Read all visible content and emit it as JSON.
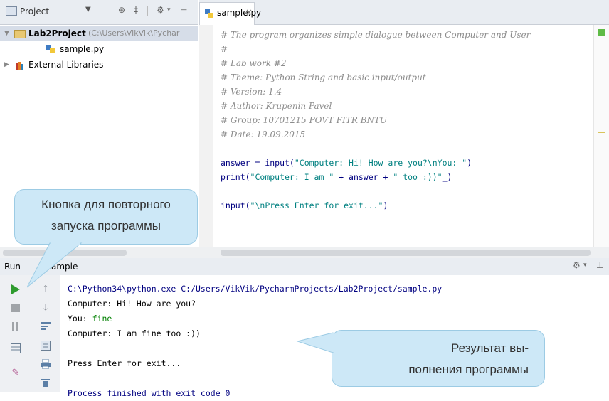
{
  "project_panel": {
    "title": "Project",
    "root_label": "Lab2Project",
    "root_path": "(C:\\Users\\VikVik\\Pychar",
    "file_label": "sample.py",
    "ext_libs_label": "External Libraries"
  },
  "editor": {
    "tab_label": "sample.py",
    "tab_close": "×",
    "lines": [
      {
        "type": "comment",
        "text": "# The program organizes simple dialogue between Computer and User"
      },
      {
        "type": "comment",
        "text": "#"
      },
      {
        "type": "comment",
        "text": "# Lab work #2"
      },
      {
        "type": "comment",
        "text": "# Theme: Python String and basic input/output"
      },
      {
        "type": "comment",
        "text": "# Version: 1.4"
      },
      {
        "type": "comment",
        "text": "# Author: Krupenin Pavel"
      },
      {
        "type": "comment",
        "text": "# Group: 10701215 POVT FITR BNTU"
      },
      {
        "type": "comment",
        "text": "# Date: 19.09.2015"
      },
      {
        "type": "blank",
        "text": ""
      },
      {
        "type": "code1",
        "a": "answer = input(",
        "s": "\"Computer: Hi! How are you?\\nYou: \"",
        "b": ")"
      },
      {
        "type": "code2",
        "a": "print(",
        "s1": "\"Computer: I am \"",
        "m": " + answer + ",
        "s2": "\" too :))\"",
        "b": "_)"
      },
      {
        "type": "blank",
        "text": ""
      },
      {
        "type": "code3",
        "a": "input(",
        "s": "\"\\nPress Enter for exit...\"",
        "b": ")"
      }
    ]
  },
  "run_panel": {
    "title_prefix": "Run",
    "title_suffix": "ample",
    "console_lines": [
      {
        "text": "C:\\Python34\\python.exe C:/Users/VikVik/PycharmProjects/Lab2Project/sample.py",
        "color": "#000080"
      },
      {
        "text": "Computer: Hi! How are you?",
        "color": "#000000"
      },
      {
        "prefix": "You: ",
        "input": "fine",
        "color": "#000000",
        "input_color": "#008000"
      },
      {
        "text": "Computer: I am fine too :))",
        "color": "#000000"
      },
      {
        "text": "",
        "color": "#000000"
      },
      {
        "text": "Press Enter for exit...",
        "color": "#000000"
      },
      {
        "text": "",
        "color": "#000000"
      },
      {
        "text": "Process finished with exit code 0",
        "color": "#000080"
      }
    ]
  },
  "callouts": {
    "rerun": {
      "line1": "Кнопка для повторного",
      "line2": "запуска программы"
    },
    "result": {
      "line1": "Результат вы-",
      "line2": "полнения программы"
    }
  },
  "colors": {
    "run_green": "#2e9b2e",
    "callout_bg": "#cde8f7",
    "comment": "#8c8c8c",
    "string": "#008080",
    "keyword_blue": "#000080"
  },
  "icons": [
    "project-icon",
    "folder-icon",
    "python-file-icon",
    "library-icon",
    "run-icon",
    "stop-icon",
    "pause-icon",
    "up-arrow-icon",
    "down-arrow-icon",
    "settings-icon",
    "pin-icon",
    "print-icon",
    "trash-icon"
  ]
}
